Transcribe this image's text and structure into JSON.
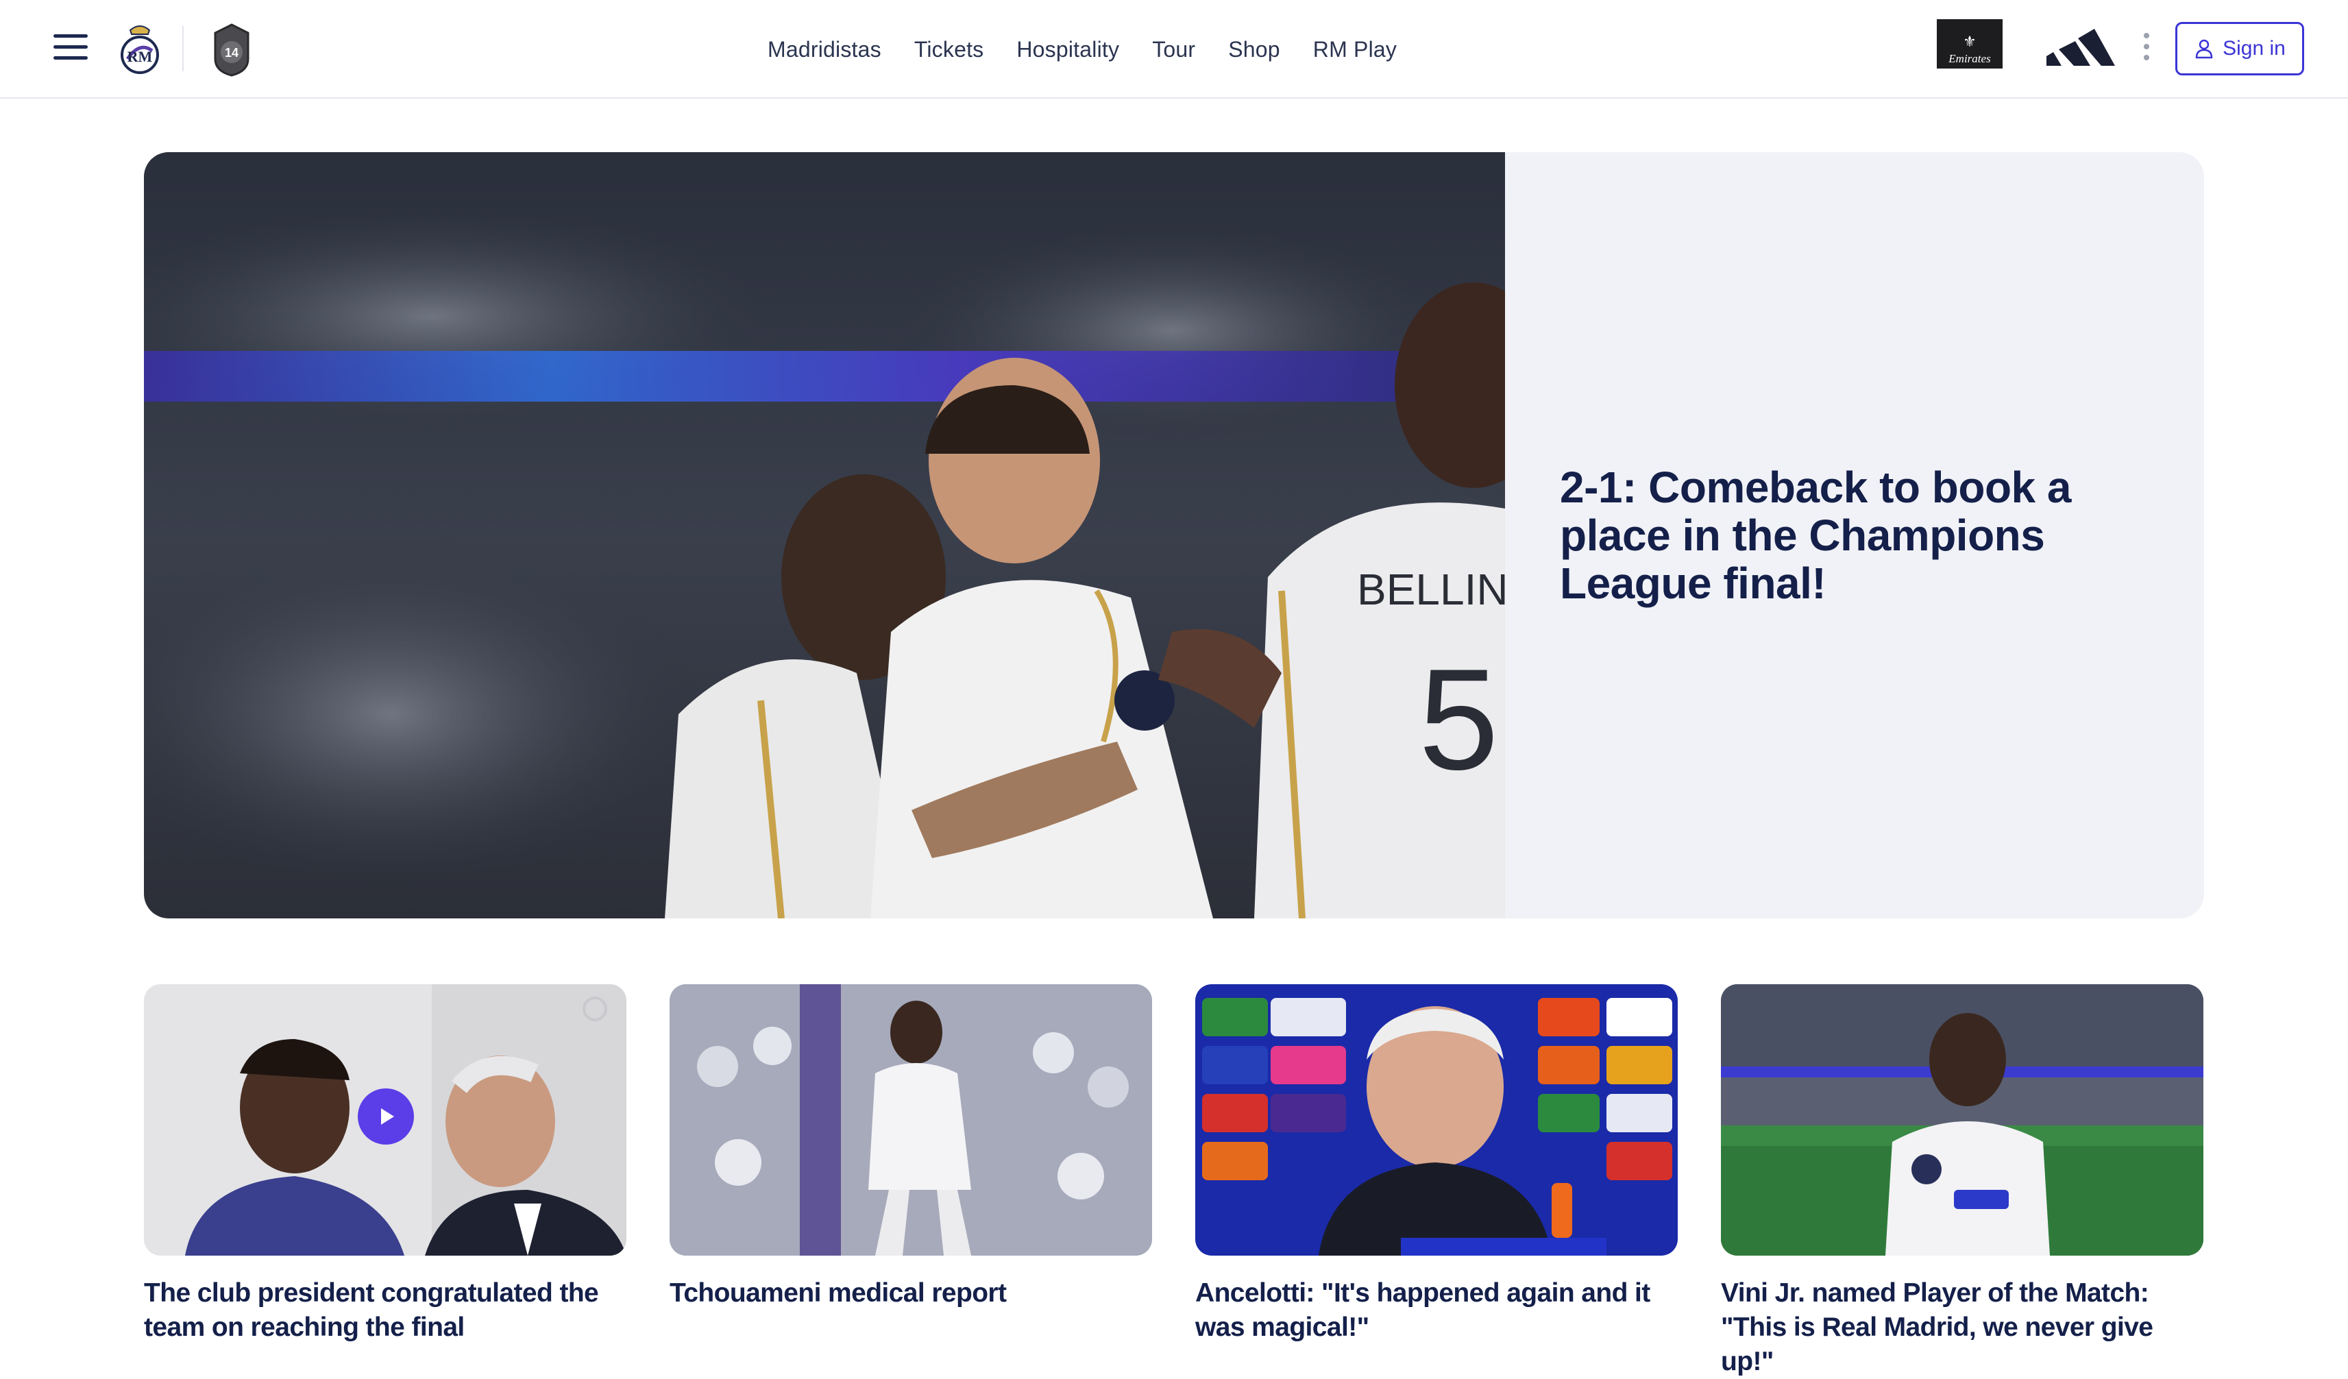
{
  "header": {
    "nav": [
      {
        "label": "Madridistas"
      },
      {
        "label": "Tickets"
      },
      {
        "label": "Hospitality"
      },
      {
        "label": "Tour"
      },
      {
        "label": "Shop"
      },
      {
        "label": "RM Play"
      }
    ],
    "sponsor_emirates": "Emirates",
    "sign_in_label": "Sign in",
    "crest_badge": "14"
  },
  "hero": {
    "title": "2-1: Comeback to book a place in the Champions League final!",
    "jersey_name": "BELLINGHA",
    "jersey_number": "5"
  },
  "cards": [
    {
      "title": "The club president congratulated the team on reaching the final",
      "has_video": true
    },
    {
      "title": "Tchouameni medical report",
      "has_video": false
    },
    {
      "title": "Ancelotti: \"It's happened again and it was magical!\"",
      "has_video": false
    },
    {
      "title": "Vini Jr. named Player of the Match: \"This is Real Madrid, we never give up!\"",
      "has_video": false
    }
  ],
  "colors": {
    "brand_navy": "#14204a",
    "accent_purple": "#3b35d6",
    "play_purple": "#5b3ee8",
    "hero_panel": "#f1f2f7"
  }
}
